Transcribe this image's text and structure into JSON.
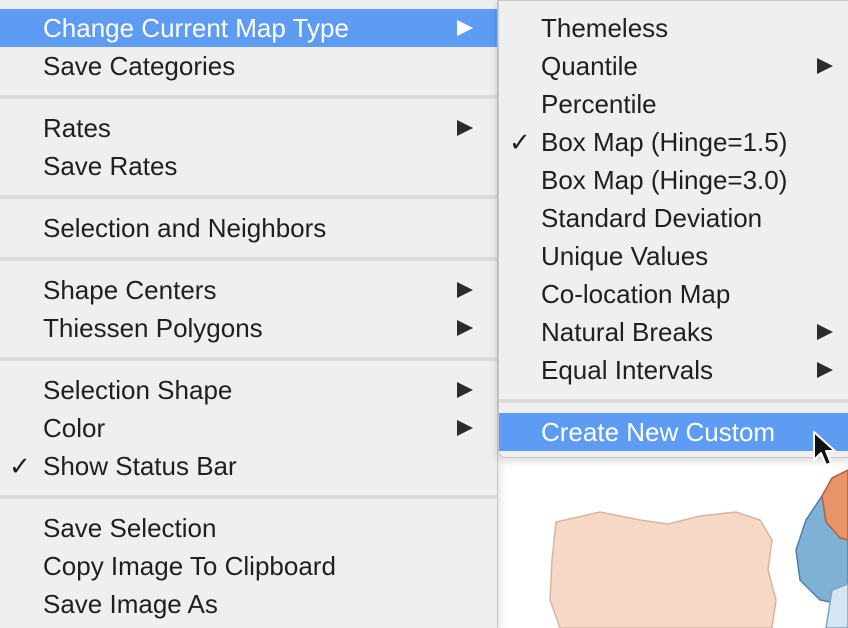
{
  "main_menu": {
    "items": [
      {
        "label": "Change Current Map Type",
        "submenu": true,
        "highlighted": true
      },
      {
        "label": "Save Categories"
      },
      {
        "label": "Rates",
        "submenu": true
      },
      {
        "label": "Save Rates"
      },
      {
        "label": "Selection and Neighbors"
      },
      {
        "label": "Shape Centers",
        "submenu": true
      },
      {
        "label": "Thiessen Polygons",
        "submenu": true
      },
      {
        "label": "Selection Shape",
        "submenu": true
      },
      {
        "label": "Color",
        "submenu": true
      },
      {
        "label": "Show Status Bar",
        "checked": true
      },
      {
        "label": "Save Selection"
      },
      {
        "label": "Copy Image To Clipboard"
      },
      {
        "label": "Save Image As"
      }
    ]
  },
  "sub_menu": {
    "items": [
      {
        "label": "Themeless"
      },
      {
        "label": "Quantile",
        "submenu": true
      },
      {
        "label": "Percentile"
      },
      {
        "label": "Box Map (Hinge=1.5)",
        "checked": true
      },
      {
        "label": "Box Map (Hinge=3.0)"
      },
      {
        "label": "Standard Deviation"
      },
      {
        "label": "Unique Values"
      },
      {
        "label": "Co-location Map"
      },
      {
        "label": "Natural Breaks",
        "submenu": true
      },
      {
        "label": "Equal Intervals",
        "submenu": true
      },
      {
        "label": "Create New Custom",
        "highlighted": true
      }
    ]
  },
  "glyphs": {
    "check": "✓"
  },
  "colors": {
    "highlight": "#5e9cf4",
    "menu_bg": "#efefef",
    "map_peach": "#f6d8c6",
    "map_orange": "#e69468",
    "map_blue": "#7fb0d6",
    "map_light_blue": "#d5e6f2"
  }
}
